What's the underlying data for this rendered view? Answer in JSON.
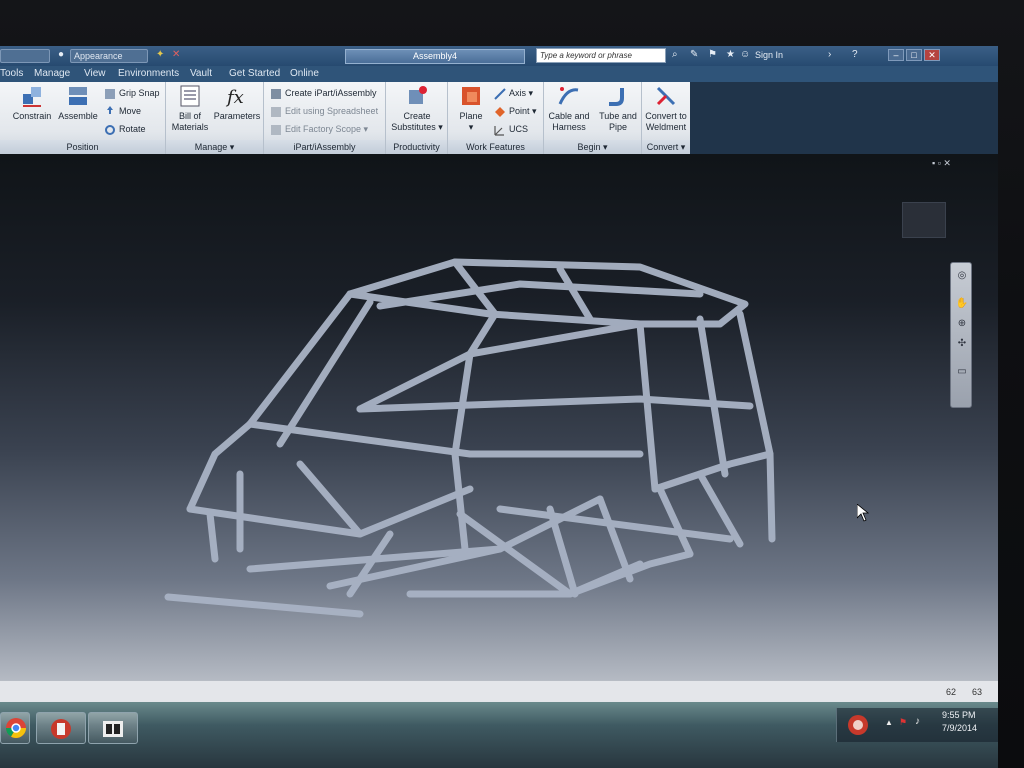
{
  "titlebar": {
    "quick_access_1": "",
    "appearance_dropdown": "Appearance",
    "document_title": "Assembly4",
    "search_placeholder": "Type a keyword or phrase",
    "sign_in": "Sign In"
  },
  "menu": {
    "tabs": [
      "Tools",
      "Manage",
      "View",
      "Environments",
      "Vault",
      "Get Started",
      "Online"
    ]
  },
  "ribbon": {
    "position": {
      "label": "Position",
      "constrain": "Constrain",
      "assemble": "Assemble",
      "grip_snap": "Grip Snap",
      "move": "Move",
      "rotate": "Rotate"
    },
    "manage": {
      "label": "Manage",
      "bill_of_materials_1": "Bill of",
      "bill_of_materials_2": "Materials",
      "parameters": "Parameters"
    },
    "ipart": {
      "label": "iPart/iAssembly",
      "create": "Create iPart/iAssembly",
      "edit_spreadsheet": "Edit using Spreadsheet",
      "edit_factory_scope": "Edit Factory Scope"
    },
    "productivity": {
      "label": "Productivity",
      "create_substitutes_1": "Create",
      "create_substitutes_2": "Substitutes"
    },
    "work_features": {
      "label": "Work Features",
      "plane": "Plane",
      "axis": "Axis",
      "point": "Point",
      "ucs": "UCS"
    },
    "begin": {
      "label": "Begin",
      "cable_harness_1": "Cable and",
      "cable_harness_2": "Harness",
      "tube_pipe_1": "Tube and",
      "tube_pipe_2": "Pipe"
    },
    "convert": {
      "label": "Convert",
      "weldment_1": "Convert to",
      "weldment_2": "Weldment"
    }
  },
  "statusbar": {
    "coord_x": "62",
    "coord_y": "63"
  },
  "taskbar": {
    "time": "9:55 PM",
    "date": "7/9/2014"
  },
  "colors": {
    "ribbon_bg": "#e8ecf0",
    "title_bar": "#2f5479",
    "tube_color": "#aab4c6",
    "viewport_top": "#101418",
    "viewport_bottom": "#d0d3d8"
  },
  "icons": {
    "constrain": "constrain-icon",
    "assemble": "assemble-icon",
    "bom": "bill-of-materials-icon",
    "parameters": "fx-icon",
    "plane": "plane-icon",
    "cable": "cable-harness-icon",
    "tube": "tube-pipe-icon",
    "weldment": "weldment-icon"
  }
}
